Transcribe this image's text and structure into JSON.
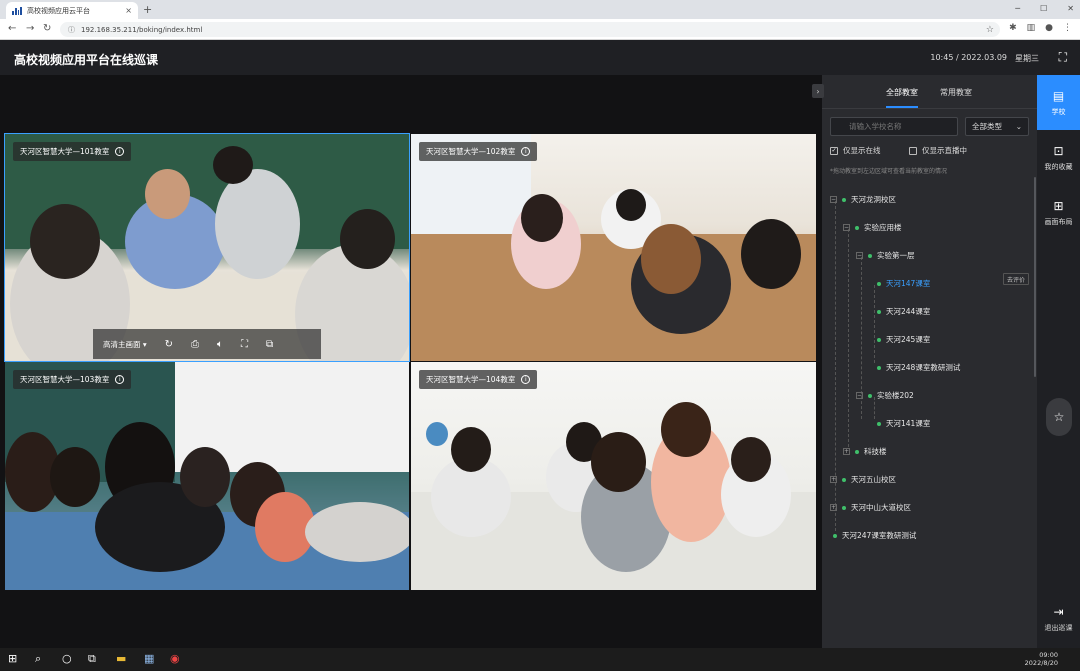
{
  "browser": {
    "tab_title": "高校视频应用云平台",
    "tab_close": "×",
    "new_tab": "+",
    "url": "192.168.35.211/boking/index.html"
  },
  "header": {
    "title": "高校视频应用平台在线巡课",
    "time": "10:45 / 2022.03.09",
    "weekday": "星期三"
  },
  "videos": [
    {
      "label": "天河区智慧大学—101教室"
    },
    {
      "label": "天河区智慧大学—102教室"
    },
    {
      "label": "天河区智慧大学—103教室"
    },
    {
      "label": "天河区智慧大学—104教室"
    }
  ],
  "video_toolbar": {
    "quality": "高清主画面"
  },
  "sidebar": {
    "tabs": [
      "全部教室",
      "常用教室"
    ],
    "search_placeholder": "请输入学校名称",
    "type_select": "全部类型",
    "only_online": "仅显示在线",
    "only_live": "仅显示直播中",
    "hint": "*拖动教室到左边区域可查看当前教室的情况",
    "evaluate": "去评价",
    "tree": [
      {
        "label": "天河龙洞校区"
      },
      {
        "label": "实验应用楼"
      },
      {
        "label": "实验第一层"
      },
      {
        "label": "天河147课室"
      },
      {
        "label": "天河244课室"
      },
      {
        "label": "天河245课室"
      },
      {
        "label": "天河248课室教研测试"
      },
      {
        "label": "实验楼202"
      },
      {
        "label": "天河141课室"
      },
      {
        "label": "科技楼"
      },
      {
        "label": "天河五山校区"
      },
      {
        "label": "天河中山大道校区"
      },
      {
        "label": "天河247课室教研测试"
      }
    ]
  },
  "rail": {
    "items": [
      {
        "label": "学校"
      },
      {
        "label": "我的收藏"
      },
      {
        "label": "画面布局"
      },
      {
        "label": "退出巡课"
      }
    ]
  },
  "taskbar": {
    "time": "09:00",
    "date": "2022/8/20"
  },
  "colors": {
    "accent": "#2b8dff",
    "online_dot": "#3fbf6a",
    "header_bg": "#1f2024",
    "sidebar_bg": "#2a2b2f"
  }
}
